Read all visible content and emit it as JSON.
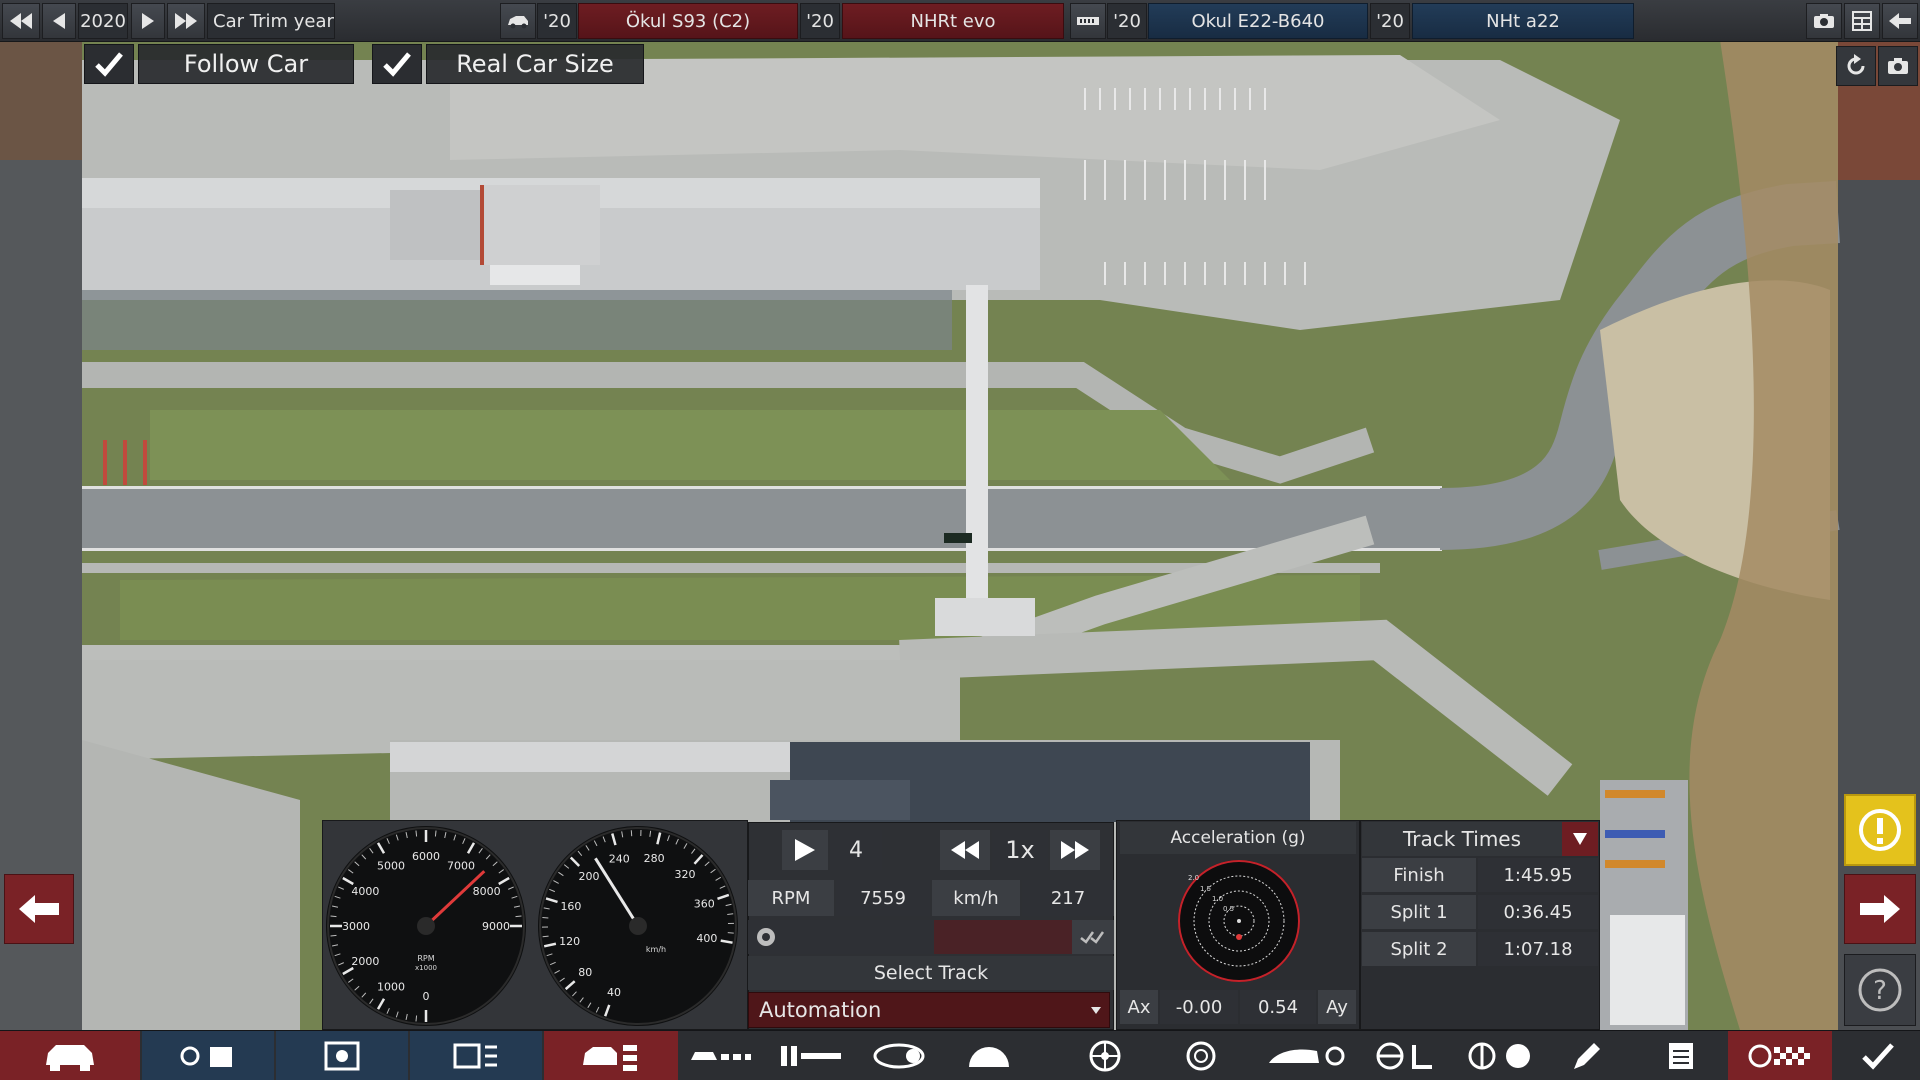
{
  "topbar": {
    "year": "2020",
    "trim_year_label": "Car Trim year",
    "cars": [
      {
        "year": "'20",
        "name": "Ökul S93 (C2)"
      },
      {
        "year": "'20",
        "name": "NHRt evo"
      },
      {
        "year": "'20",
        "name": "Okul E22-B640"
      },
      {
        "year": "'20",
        "name": "NHt a22"
      }
    ]
  },
  "toggles": {
    "follow_car": "Follow Car",
    "real_car_size": "Real Car Size"
  },
  "gauges": {
    "tachometer": {
      "ticks": [
        "0",
        "1000",
        "2000",
        "3000",
        "4000",
        "5000",
        "6000",
        "7000",
        "8000",
        "9000"
      ],
      "unit": "RPM",
      "unit2": "x1000",
      "needle_rpm": 7559
    },
    "speedometer": {
      "ticks": [
        "40",
        "80",
        "120",
        "160",
        "200",
        "240",
        "280",
        "320",
        "360",
        "400"
      ],
      "unit": "km/h",
      "needle_kmh": 217
    }
  },
  "playback": {
    "gear": "4",
    "speed_multiplier": "1x",
    "rpm_label": "RPM",
    "rpm_value": "7559",
    "speed_label": "km/h",
    "speed_value": "217",
    "select_track_label": "Select Track",
    "track_selected": "Automation"
  },
  "acceleration": {
    "title": "Acceleration (g)",
    "ax_label": "Ax",
    "ax_value": "-0.00",
    "ay_value": "0.54",
    "ay_label": "Ay",
    "ring_labels": [
      "2.0",
      "1.5",
      "1.0",
      "0.5"
    ]
  },
  "track_times": {
    "title": "Track Times",
    "rows": [
      {
        "label": "Finish",
        "time": "1:45.95"
      },
      {
        "label": "Split 1",
        "time": "0:36.45"
      },
      {
        "label": "Split 2",
        "time": "1:07.18"
      }
    ]
  },
  "colors": {
    "red_accent": "#6e1d22",
    "blue_accent": "#223c58",
    "warning": "#e4c21c"
  }
}
